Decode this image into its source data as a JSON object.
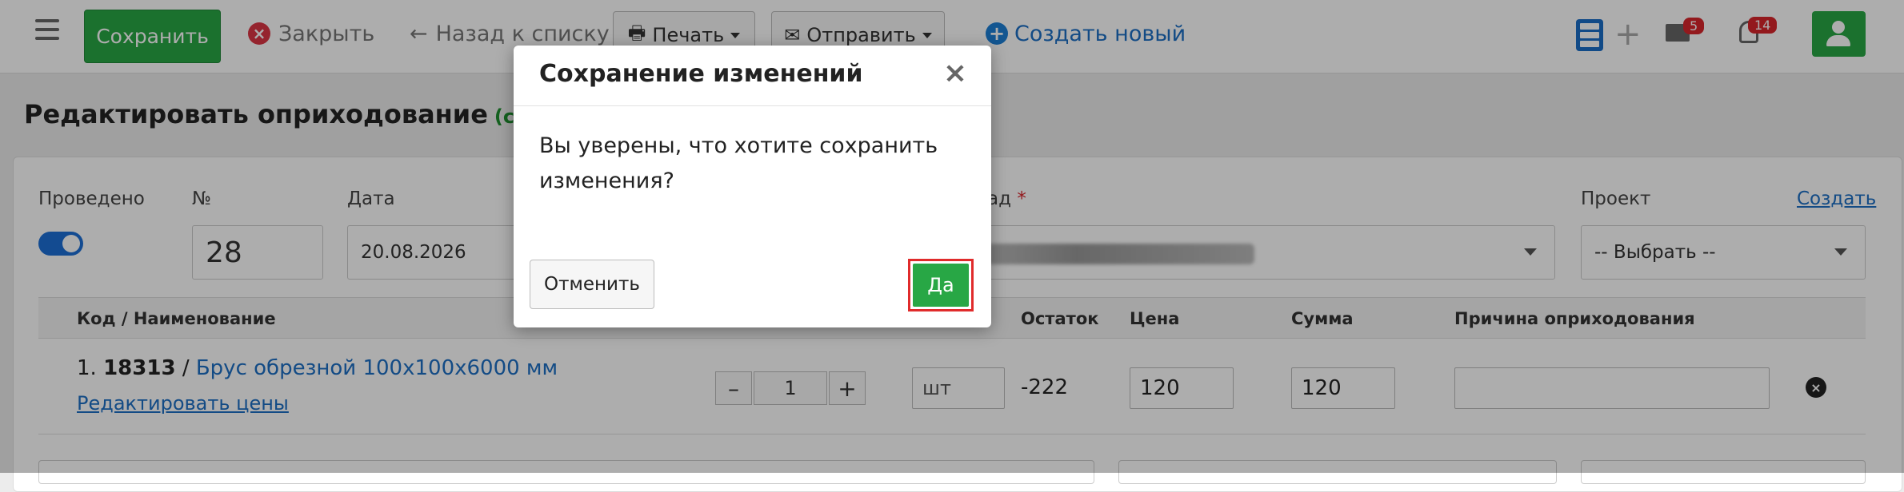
{
  "toolbar": {
    "save": "Сохранить",
    "close": "Закрыть",
    "back": "Назад к списку",
    "print": "Печать",
    "send": "Отправить",
    "create_new": "Создать новый",
    "messages_count": "5",
    "notifications_count": "14"
  },
  "page": {
    "title": "Редактировать оприходование",
    "saved_note": "(сохран"
  },
  "form": {
    "posted_label": "Проведено",
    "posted": true,
    "number_label": "№",
    "number_value": "28",
    "date_label": "Дата",
    "date_value": "20.08.2026",
    "warehouse_label_partial": "ад",
    "warehouse_required_mark": "*",
    "project_label": "Проект",
    "project_create_link": "Создать",
    "project_value": "-- Выбрать --"
  },
  "table": {
    "headers": {
      "code_name": "Код / Наименование",
      "remainder": "Остаток",
      "price": "Цена",
      "sum": "Сумма",
      "reason": "Причина оприходования"
    },
    "rows": [
      {
        "index": "1.",
        "code": "18313",
        "separator": "/",
        "name": "Брус обрезной 100х100х6000 мм",
        "edit_prices": "Редактировать цены",
        "qty_minus": "–",
        "qty": "1",
        "qty_plus": "+",
        "unit": "шт",
        "remainder": "-222",
        "price": "120",
        "sum": "120",
        "reason": ""
      }
    ]
  },
  "modal": {
    "title": "Сохранение изменений",
    "close_symbol": "×",
    "body": "Вы уверены, что хотите сохранить изменения?",
    "cancel": "Отменить",
    "confirm": "Да"
  },
  "colors": {
    "accent_green": "#28a745",
    "link_blue": "#1d6fc5",
    "badge_red": "#d9262c",
    "highlight_red": "#e02b2b"
  }
}
